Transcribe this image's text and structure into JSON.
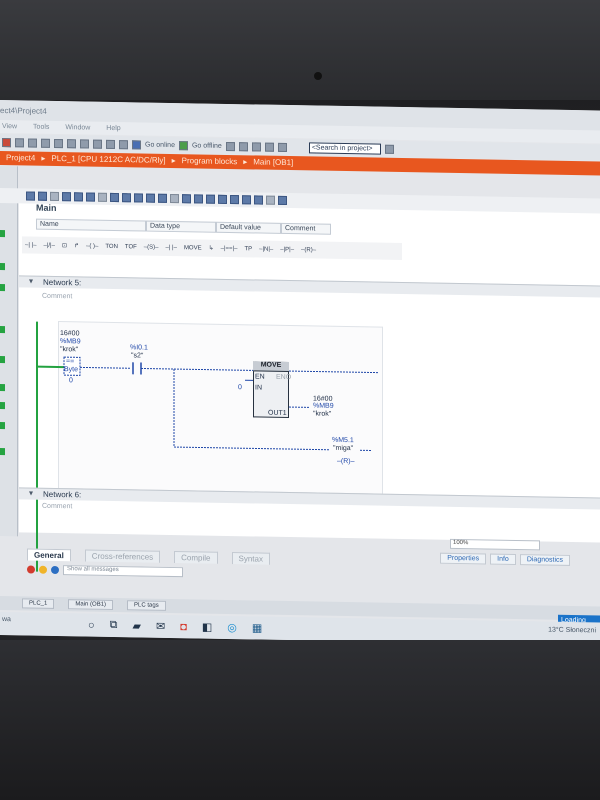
{
  "window": {
    "title": "ect4\\Project4"
  },
  "menu": [
    "View",
    "Tools",
    "Window",
    "Help"
  ],
  "toolbar": {
    "go_online": "Go online",
    "go_offline": "Go offline",
    "search_placeholder": "<Search in project>"
  },
  "breadcrumb": [
    "Project4",
    "PLC_1 [CPU 1212C AC/DC/Rly]",
    "Program blocks",
    "Main [OB1]"
  ],
  "block_interface": {
    "title": "Main",
    "columns": [
      "Name",
      "Data type",
      "Default value",
      "Comment"
    ]
  },
  "ladder_toolbar": [
    "TON",
    "TOF",
    "MOVE",
    "TP"
  ],
  "networks": [
    {
      "title": "Network 5:",
      "comment": "Comment",
      "compare_operand": {
        "value": "16#00",
        "address": "%MB9",
        "symbol": "\"krok\"",
        "op": "==",
        "type": "Byte",
        "constant": "0"
      },
      "contact": {
        "address": "%I0.1",
        "symbol": "\"s2\""
      },
      "move_block": {
        "title": "MOVE",
        "en": "EN",
        "eno": "ENO",
        "in_label": "IN",
        "in_value": "0",
        "out_label": "OUT1",
        "out_value": "16#00",
        "out_address": "%MB9",
        "out_symbol": "\"krok\""
      },
      "coil": {
        "address": "%M5.1",
        "symbol": "\"miga\"",
        "type": "R"
      }
    },
    {
      "title": "Network 6:",
      "comment": "Comment"
    }
  ],
  "zoom": "100%",
  "bottom_tabs": [
    "General",
    "Cross-references",
    "Compile",
    "Syntax"
  ],
  "inspector_tabs": [
    "Properties",
    "Info",
    "Diagnostics"
  ],
  "messages_filter": "Show all messages",
  "portal_tabs": [
    "PLC_1",
    "Main (OB1)",
    "PLC tags"
  ],
  "loading": "Loading",
  "taskbar": {
    "left_text": "wa",
    "weather": "13°C  Słoneczni"
  },
  "colors": {
    "breadcrumb_bg": "#e8571f",
    "rail_green": "#23a240",
    "wire_blue": "#1f47a8"
  }
}
